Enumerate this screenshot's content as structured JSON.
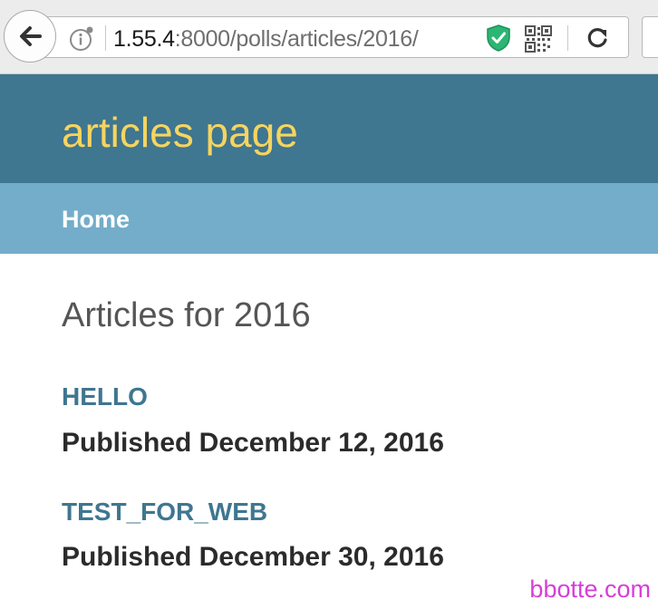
{
  "browser": {
    "url_host": "1.55.4",
    "url_path": ":8000/polls/articles/2016/",
    "shield_color": "#2bb673"
  },
  "site": {
    "title": "articles page",
    "nav": [
      {
        "label": "Home"
      }
    ]
  },
  "main": {
    "heading": "Articles for 2016",
    "articles": [
      {
        "title": "HELLO",
        "published": "Published December 12, 2016"
      },
      {
        "title": "TEST_FOR_WEB",
        "published": "Published December 30, 2016"
      }
    ]
  },
  "watermark": "bbotte.com",
  "colors": {
    "header_bg": "#3f7690",
    "nav_bg": "#74adc9",
    "title_color": "#f6d45f",
    "link_color": "#3f7690"
  }
}
